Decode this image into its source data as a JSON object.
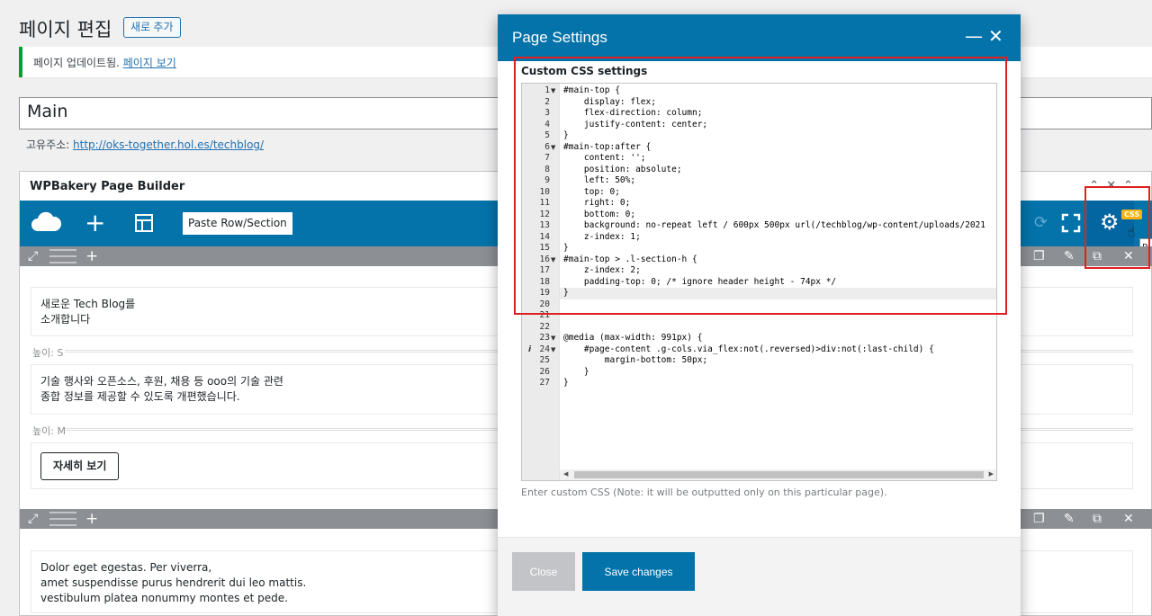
{
  "page": {
    "title": "페이지 편집",
    "add_new_label": "새로 추가",
    "notice_text": "페이지 업데이트됨. ",
    "notice_link": "페이지 보기",
    "post_title": "Main",
    "permalink_label": "고유주소: ",
    "permalink_url": "http://oks-together.hol.es/techblog/"
  },
  "builder": {
    "title": "WPBakery Page Builder",
    "paste_label": "Paste Row/Section",
    "css_badge": "CSS",
    "tooltip_text": "P",
    "rows": [
      {
        "text_line1": "새로운 Tech Blog를",
        "text_line2": "소개합니다",
        "spacer1": "높이: S",
        "para_line1": "기술 행사와 오픈소스, 후원, 채용 등 ooo의 기술 관련",
        "para_line2": "종합 정보를 제공할 수 있도록 개편했습니다.",
        "spacer2": "높이: M",
        "button_label": "자세히 보기"
      },
      {
        "line1": "Dolor eget egestas. Per viverra,",
        "line2": "amet suspendisse purus hendrerit dui leo mattis.",
        "line3": "vestibulum platea nonummy montes et pede."
      }
    ]
  },
  "modal": {
    "title": "Page Settings",
    "section_label": "Custom CSS settings",
    "note": "Enter custom CSS (Note: it will be outputted only on this particular page).",
    "close_label": "Close",
    "save_label": "Save changes",
    "active_line": 19,
    "code_lines": [
      {
        "n": "1",
        "t": "#main-top {"
      },
      {
        "n": "2",
        "t": "    display: flex;"
      },
      {
        "n": "3",
        "t": "    flex-direction: column;"
      },
      {
        "n": "4",
        "t": "    justify-content: center;"
      },
      {
        "n": "5",
        "t": "}"
      },
      {
        "n": "6",
        "t": "#main-top:after {"
      },
      {
        "n": "7",
        "t": "    content: '';"
      },
      {
        "n": "8",
        "t": "    position: absolute;"
      },
      {
        "n": "9",
        "t": "    left: 50%;"
      },
      {
        "n": "10",
        "t": "    top: 0;"
      },
      {
        "n": "11",
        "t": "    right: 0;"
      },
      {
        "n": "12",
        "t": "    bottom: 0;"
      },
      {
        "n": "13",
        "t": "    background: no-repeat left / 600px 500px url(/techblog/wp-content/uploads/2021"
      },
      {
        "n": "14",
        "t": "    z-index: 1;"
      },
      {
        "n": "15",
        "t": "}"
      },
      {
        "n": "16",
        "t": "#main-top > .l-section-h {"
      },
      {
        "n": "17",
        "t": "    z-index: 2;"
      },
      {
        "n": "18",
        "t": "    padding-top: 0; /* ignore header height - 74px */"
      },
      {
        "n": "19",
        "t": "}"
      },
      {
        "n": "20",
        "t": ""
      },
      {
        "n": "21",
        "t": ""
      },
      {
        "n": "22",
        "t": ""
      },
      {
        "n": "23",
        "t": "@media (max-width: 991px) {"
      },
      {
        "n": "24",
        "t": "    #page-content .g-cols.via_flex:not(.reversed)>div:not(:last-child) {"
      },
      {
        "n": "25",
        "t": "        margin-bottom: 50px;"
      },
      {
        "n": "26",
        "t": "    }"
      },
      {
        "n": "27",
        "t": "}"
      }
    ]
  },
  "colors": {
    "accent": "#0473aa",
    "highlight": "#e02020",
    "badge": "#f8b312"
  }
}
